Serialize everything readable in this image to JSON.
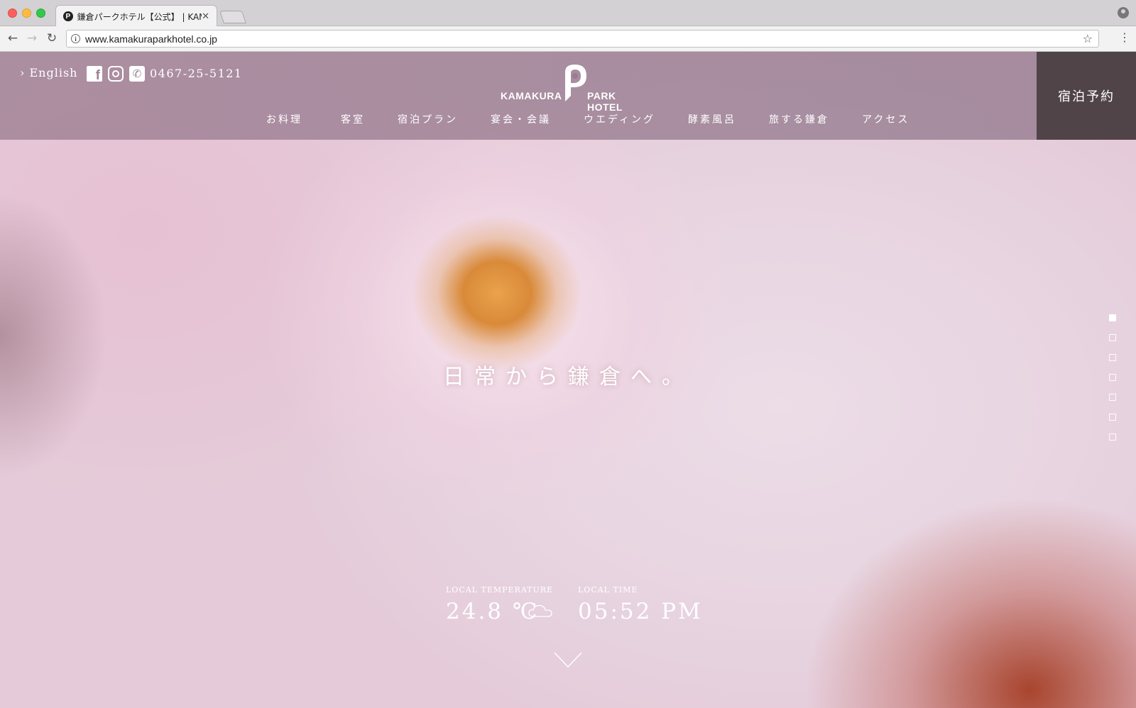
{
  "browser": {
    "tab_title": "鎌倉パークホテル【公式】 | KAMAKURA PARK HOTEL",
    "tab_favicon": "P",
    "url": "www.kamakuraparkhotel.co.jp"
  },
  "header": {
    "english_label": "› English",
    "phone": "0467-25-5121",
    "logo_left": "KAMAKURA",
    "logo_right": "PARK HOTEL",
    "booking_label": "宿泊予約",
    "nav": [
      "お料理",
      "客室",
      "宿泊プラン",
      "宴会・会議",
      "ウエディング",
      "酵素風呂",
      "旅する鎌倉",
      "アクセス"
    ]
  },
  "hero": {
    "catchphrase": "日常から鎌倉へ。",
    "slides_total": 7,
    "active_slide": 1
  },
  "weather": {
    "temp_label": "LOCAL TEMPERATURE",
    "temp_value": "24.8 ℃",
    "time_label": "LOCAL TIME",
    "time_value": "05:52 PM",
    "condition_icon": "cloud-icon"
  },
  "colors": {
    "header_overlay": "#9a8497",
    "booking_bg": "#504448",
    "text": "#ffffff"
  }
}
